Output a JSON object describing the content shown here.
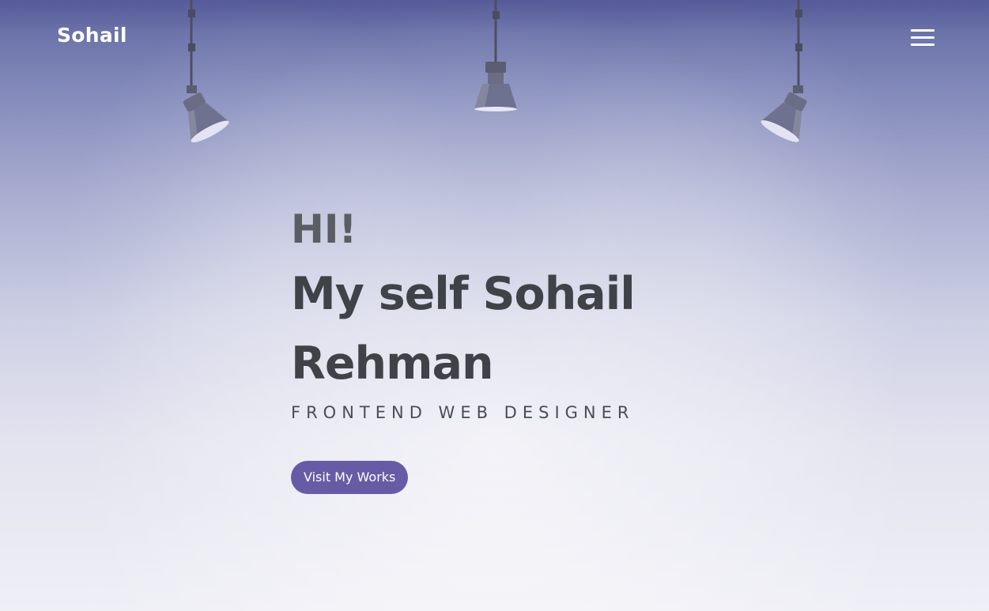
{
  "nav": {
    "logo": "Sohail",
    "menu_icon": "hamburger-menu-icon"
  },
  "hero": {
    "greeting": "HI!",
    "headline": "My self Sohail Rehman",
    "subtitle": "FRONTEND WEB DESIGNER",
    "cta_label": "Visit My Works"
  },
  "decorations": {
    "lamps": [
      "spotlight-lamp-icon",
      "spotlight-lamp-icon",
      "spotlight-lamp-icon"
    ]
  },
  "colors": {
    "accent": "#685ba6",
    "heading": "#3f4348",
    "greeting": "#5a5d63",
    "background_top": "#5f66a0",
    "background_bottom": "#efeff6"
  }
}
